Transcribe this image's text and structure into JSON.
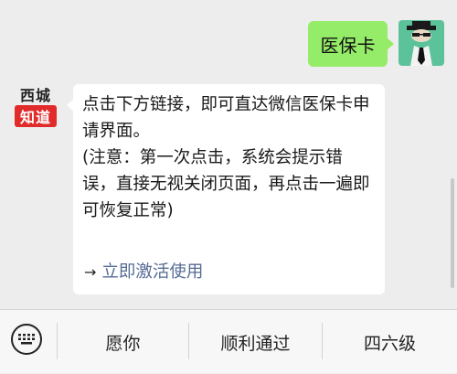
{
  "chat": {
    "outgoing_message": "医保卡",
    "bot_avatar": {
      "line1": "西城",
      "line2": "知道"
    },
    "reply_text": "点击下方链接，即可直达微信医保卡申请界面。\n(注意：第一次点击，系统会提示错误，直接无视关闭页面，再点击一遍即可恢复正常)",
    "link_arrow": "→",
    "link_text": "立即激活使用"
  },
  "menu": {
    "keyboard_icon": "keyboard-icon",
    "items": [
      {
        "label": "愿你"
      },
      {
        "label": "顺利通过"
      },
      {
        "label": "四六级"
      }
    ]
  },
  "colors": {
    "background": "#ededed",
    "outgoing_bubble": "#95ec69",
    "incoming_bubble": "#ffffff",
    "link": "#576b95",
    "badge_red": "#e12a2a",
    "avatar_green": "#5cc29a"
  }
}
